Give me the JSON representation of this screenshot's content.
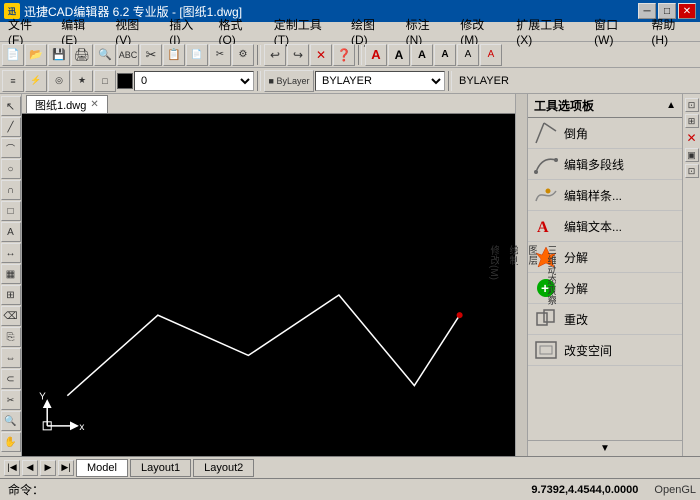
{
  "titleBar": {
    "appIcon": "迅",
    "title": "迅捷CAD编辑器 6.2 专业版 - [图纸1.dwg]",
    "minimize": "─",
    "maximize": "□",
    "close": "✕"
  },
  "menuBar": {
    "items": [
      "文件(F)",
      "编辑(E)",
      "视图(V)",
      "插入(I)",
      "格式(O)",
      "定制工具(T)",
      "绘图(D)",
      "标注(N)",
      "修改(M)",
      "扩展工具(X)",
      "窗口(W)",
      "帮助(H)"
    ]
  },
  "toolbar1": {
    "buttons": [
      "📄",
      "📂",
      "💾",
      "🖨",
      "👁",
      "✂",
      "📋",
      "↩",
      "↪",
      "✕",
      "❓"
    ],
    "textBtns": [
      "A",
      "A",
      "A",
      "A",
      "A"
    ]
  },
  "toolbar2": {
    "layerValue": "0",
    "linetypeValue": "BYLAYER",
    "colorValue": "BYLAYER"
  },
  "canvas": {
    "tabName": "图纸1.dwg",
    "axisX": "x",
    "axisY": "Y"
  },
  "tabs": {
    "model": "Model",
    "layout1": "Layout1",
    "layout2": "Layout2"
  },
  "rightPanel": {
    "title": "工具选项板",
    "sideLabels": [
      "修改(M)",
      "绘制",
      "图层",
      "三维动态观察"
    ],
    "tools": [
      {
        "name": "倒角",
        "iconType": "chamfer"
      },
      {
        "name": "编辑多段线",
        "iconType": "polyline"
      },
      {
        "name": "编辑样条...",
        "iconType": "spline"
      },
      {
        "name": "编辑文本...",
        "iconType": "text"
      },
      {
        "name": "分解",
        "iconType": "explode"
      },
      {
        "name": "分解",
        "iconType": "explode2"
      },
      {
        "name": "重改",
        "iconType": "redo"
      },
      {
        "name": "改变空间",
        "iconType": "space"
      }
    ]
  },
  "statusBar": {
    "prompt": "命令：",
    "coords": "9.7392,4.4544,0.0000",
    "renderer": "OpenGL"
  }
}
